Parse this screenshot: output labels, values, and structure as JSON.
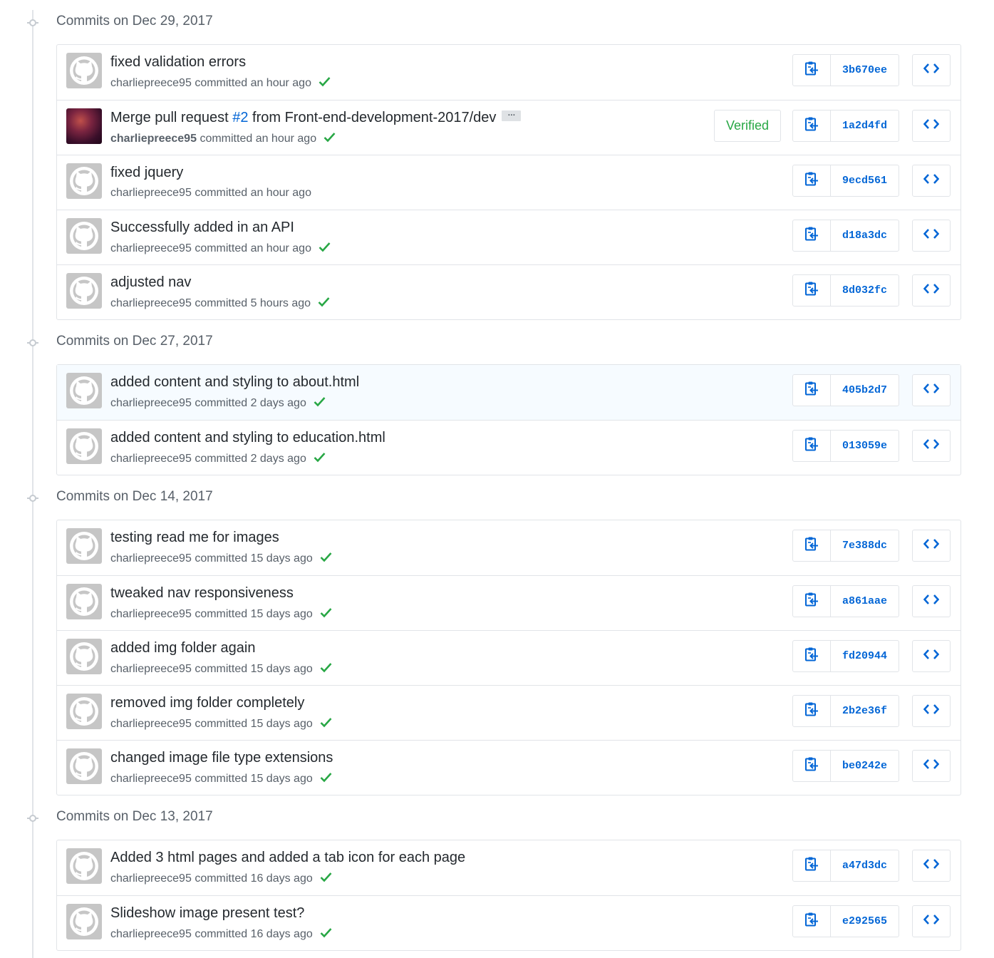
{
  "colors": {
    "link": "#0366d6",
    "success": "#28a745",
    "border": "#e1e4e8",
    "muted_text": "#586069",
    "highlight_row": "#f6fbff"
  },
  "icons": {
    "timeline_node": "commit-node-icon",
    "status": "check-icon",
    "copy": "clipboard-icon",
    "browse": "code-icon",
    "avatar_default": "github-octocat-icon"
  },
  "groups": [
    {
      "title": "Commits on Dec 29, 2017",
      "commits": [
        {
          "title": "fixed validation errors",
          "author": "charliepreece95",
          "verb": "committed",
          "time": "an hour ago",
          "sha": "3b670ee",
          "check": true
        },
        {
          "title_pre": "Merge pull request ",
          "pr": "#2",
          "title_post": " from Front-end-development-2017/dev",
          "ellipsis": "…",
          "author": "charliepreece95",
          "author_bold": true,
          "avatar_photo": true,
          "verb": "committed",
          "time": "an hour ago",
          "sha": "1a2d4fd",
          "check": true,
          "verified": "Verified"
        },
        {
          "title": "fixed jquery",
          "author": "charliepreece95",
          "verb": "committed",
          "time": "an hour ago",
          "sha": "9ecd561",
          "check": false
        },
        {
          "title": "Successfully added in an API",
          "author": "charliepreece95",
          "verb": "committed",
          "time": "an hour ago",
          "sha": "d18a3dc",
          "check": true
        },
        {
          "title": "adjusted nav",
          "author": "charliepreece95",
          "verb": "committed",
          "time": "5 hours ago",
          "sha": "8d032fc",
          "check": true
        }
      ]
    },
    {
      "title": "Commits on Dec 27, 2017",
      "commits": [
        {
          "title": "added content and styling to about.html",
          "author": "charliepreece95",
          "verb": "committed",
          "time": "2 days ago",
          "sha": "405b2d7",
          "check": true,
          "highlight": true
        },
        {
          "title": "added content and styling to education.html",
          "author": "charliepreece95",
          "verb": "committed",
          "time": "2 days ago",
          "sha": "013059e",
          "check": true
        }
      ]
    },
    {
      "title": "Commits on Dec 14, 2017",
      "commits": [
        {
          "title": "testing read me for images",
          "author": "charliepreece95",
          "verb": "committed",
          "time": "15 days ago",
          "sha": "7e388dc",
          "check": true
        },
        {
          "title": "tweaked nav responsiveness",
          "author": "charliepreece95",
          "verb": "committed",
          "time": "15 days ago",
          "sha": "a861aae",
          "check": true
        },
        {
          "title": "added img folder again",
          "author": "charliepreece95",
          "verb": "committed",
          "time": "15 days ago",
          "sha": "fd20944",
          "check": true
        },
        {
          "title": "removed img folder completely",
          "author": "charliepreece95",
          "verb": "committed",
          "time": "15 days ago",
          "sha": "2b2e36f",
          "check": true
        },
        {
          "title": "changed image file type extensions",
          "author": "charliepreece95",
          "verb": "committed",
          "time": "15 days ago",
          "sha": "be0242e",
          "check": true
        }
      ]
    },
    {
      "title": "Commits on Dec 13, 2017",
      "commits": [
        {
          "title": "Added 3 html pages and added a tab icon for each page",
          "author": "charliepreece95",
          "verb": "committed",
          "time": "16 days ago",
          "sha": "a47d3dc",
          "check": true
        },
        {
          "title": "Slideshow image present test?",
          "author": "charliepreece95",
          "verb": "committed",
          "time": "16 days ago",
          "sha": "e292565",
          "check": true
        }
      ]
    }
  ]
}
